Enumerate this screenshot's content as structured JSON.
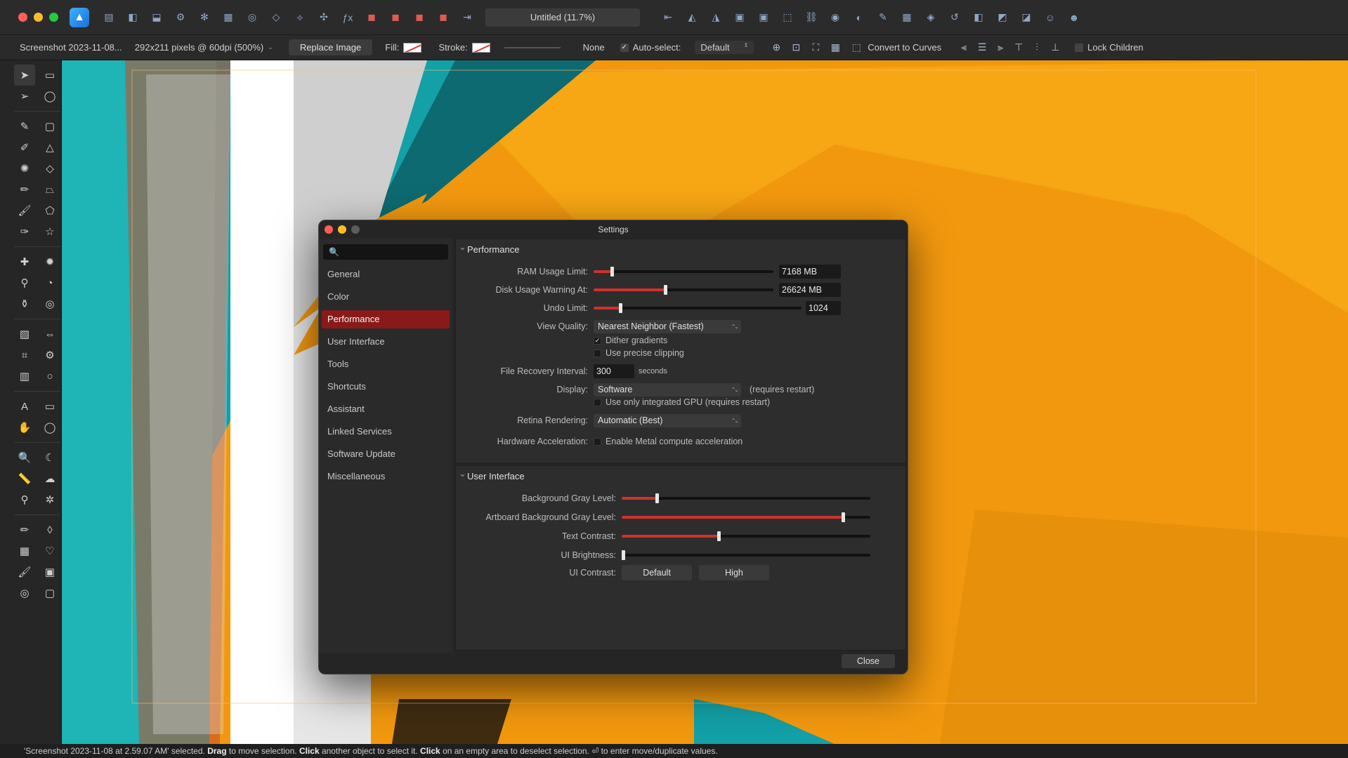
{
  "window": {
    "doc_title": "Untitled (11.7%)"
  },
  "toolbar": {
    "icons": [
      "persona-designer-icon",
      "persona-pixel-icon",
      "persona-export-icon",
      "gear-icon",
      "settings-alt-icon",
      "grid-icon",
      "snap-icon",
      "transform-icon",
      "warp-icon",
      "mesh-icon",
      "fx-icon",
      "boolean-add-icon",
      "boolean-subtract-icon",
      "boolean-intersect-icon",
      "boolean-xor-icon",
      "align-icon",
      "flip-h-icon",
      "flip-v-icon",
      "move-front-icon",
      "move-back-icon",
      "snapping-icon",
      "constraint-icon",
      "link-icon",
      "eye-icon",
      "layers-icon",
      "brush-icon",
      "swatches-icon",
      "transform-panel-icon",
      "history-icon",
      "navigator-icon",
      "assets-icon",
      "symbols-icon",
      "emoji-icon",
      "user-icon"
    ]
  },
  "context": {
    "layer_name": "Screenshot 2023-11-08...",
    "image_info": "292x211 pixels @ 60dpi (500%)",
    "replace_image": "Replace Image",
    "fill_label": "Fill:",
    "stroke_label": "Stroke:",
    "stroke_value": "None",
    "auto_select_label": "Auto-select:",
    "auto_select_value": "Default",
    "convert_to_curves": "Convert to Curves",
    "lock_children": "Lock Children"
  },
  "tools": [
    "move-tool-icon",
    "rect-select-icon",
    "node-tool-icon",
    "ellipse-select-icon",
    "pen-tool-icon",
    "rounded-rect-icon",
    "vector-brush-icon",
    "triangle-icon",
    "color-picker-icon",
    "diamond-icon",
    "pencil-icon",
    "trapezoid-icon",
    "brush-icon",
    "pentagon-icon",
    "paint-icon",
    "star-icon",
    "retouch-icon",
    "gear-shape-icon",
    "dodge-icon",
    "pie-icon",
    "fill-icon",
    "donut-icon",
    "image-icon",
    "arrow-icon",
    "crop-icon",
    "cog-icon",
    "frame-text-icon",
    "circle-icon",
    "artistic-text-icon",
    "speech-icon",
    "hand-icon",
    "callout-icon",
    "zoom-icon",
    "moon-icon",
    "ruler-icon",
    "cloud-icon",
    "eyedropper-icon",
    "cog2-icon",
    "measure-icon",
    "tear-icon",
    "table-icon",
    "heart-icon",
    "brush2-icon",
    "photo-icon",
    "transparency-icon",
    "select-box-icon"
  ],
  "canvas": {
    "bg": "#f2980f",
    "teal": "#13a0a6",
    "dark_teal": "#0d6a70"
  },
  "dialog": {
    "title": "Settings",
    "search_placeholder": "🔍",
    "nav": [
      "General",
      "Color",
      "Performance",
      "User Interface",
      "Tools",
      "Shortcuts",
      "Assistant",
      "Linked Services",
      "Software Update",
      "Miscellaneous"
    ],
    "active_nav": "Performance",
    "performance": {
      "heading": "Performance",
      "ram_label": "RAM Usage Limit:",
      "ram_value": "7168 MB",
      "ram_fraction": 0.1,
      "disk_label": "Disk Usage Warning At:",
      "disk_value": "26624 MB",
      "disk_fraction": 0.4,
      "undo_label": "Undo Limit:",
      "undo_value": "1024",
      "undo_fraction": 0.13,
      "view_quality_label": "View Quality:",
      "view_quality_value": "Nearest Neighbor (Fastest)",
      "dither_label": "Dither gradients",
      "precise_clip_label": "Use precise clipping",
      "recovery_label": "File Recovery Interval:",
      "recovery_value": "300",
      "recovery_unit": "seconds",
      "display_label": "Display:",
      "display_value": "Software",
      "display_hint": "(requires restart)",
      "integrated_gpu_label": "Use only integrated GPU (requires restart)",
      "retina_label": "Retina Rendering:",
      "retina_value": "Automatic (Best)",
      "hw_label": "Hardware Acceleration:",
      "metal_label": "Enable Metal compute acceleration"
    },
    "ui": {
      "heading": "User Interface",
      "bg_gray_label": "Background Gray Level:",
      "bg_gray_fraction": 0.14,
      "artboard_label": "Artboard Background Gray Level:",
      "artboard_fraction": 0.89,
      "text_contrast_label": "Text Contrast:",
      "text_contrast_fraction": 0.39,
      "brightness_label": "UI Brightness:",
      "brightness_fraction": 0.0,
      "contrast_label": "UI Contrast:",
      "contrast_default": "Default",
      "contrast_high": "High"
    },
    "close": "Close"
  },
  "status": {
    "p1": "'Screenshot 2023-11-08 at 2.59.07 AM' selected. ",
    "b1": "Drag",
    "p2": " to move selection. ",
    "b2": "Click",
    "p3": " another object to select it. ",
    "b3": "Click",
    "p4": " on an empty area to deselect selection. ⏎ to enter move/duplicate values."
  }
}
